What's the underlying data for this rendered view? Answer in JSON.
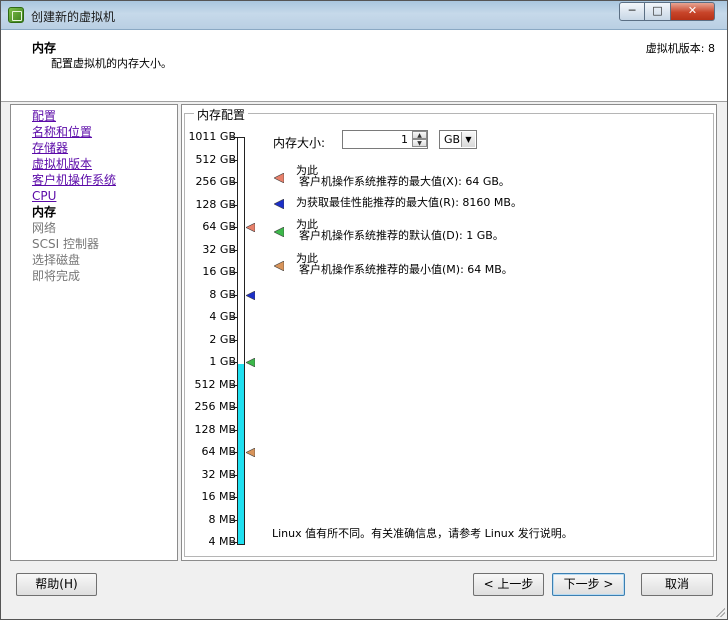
{
  "window": {
    "title": "创建新的虚拟机",
    "minimize": "─",
    "maximize": "□",
    "close": "✕"
  },
  "header": {
    "title": "内存",
    "subtitle": "配置虚拟机的内存大小。",
    "version": "虚拟机版本: 8"
  },
  "nav": {
    "items": [
      {
        "label": "配置",
        "state": "done"
      },
      {
        "label": "名称和位置",
        "state": "done"
      },
      {
        "label": "存储器",
        "state": "done"
      },
      {
        "label": "虚拟机版本",
        "state": "done"
      },
      {
        "label": "客户机操作系统",
        "state": "done"
      },
      {
        "label": "CPU",
        "state": "done"
      },
      {
        "label": "内存",
        "state": "current"
      },
      {
        "label": "网络",
        "state": "future"
      },
      {
        "label": "SCSI 控制器",
        "state": "future"
      },
      {
        "label": "选择磁盘",
        "state": "future"
      },
      {
        "label": "即将完成",
        "state": "future"
      }
    ]
  },
  "memory": {
    "group_title": "内存配置",
    "size_label": "内存大小:",
    "value": "1",
    "unit": "GB",
    "scale_labels": [
      "1011 GB",
      "512 GB",
      "256 GB",
      "128 GB",
      "64 GB",
      "32 GB",
      "16 GB",
      "8 GB",
      "4 GB",
      "2 GB",
      "1 GB",
      "512 MB",
      "256 MB",
      "128 MB",
      "64 MB",
      "32 MB",
      "16 MB",
      "8 MB",
      "4 MB"
    ],
    "selected_fraction": 0.444,
    "legend": [
      {
        "prefix": "为此",
        "text": "客户机操作系统推荐的最大值(X): 64 GB。",
        "color": "#e8806a"
      },
      {
        "prefix": "",
        "text": "为获取最佳性能推荐的最大值(R): 8160 MB。",
        "color": "#1c2fc8"
      },
      {
        "prefix": "为此",
        "text": "客户机操作系统推荐的默认值(D): 1 GB。",
        "color": "#3cb84a"
      },
      {
        "prefix": "为此",
        "text": "客户机操作系统推荐的最小值(M): 64 MB。",
        "color": "#d8945a"
      }
    ],
    "footnote": "Linux 值有所不同。有关准确信息，请参考 Linux 发行说明。"
  },
  "buttons": {
    "help": "帮助(H)",
    "back": "< 上一步",
    "next": "下一步 >",
    "cancel": "取消"
  }
}
